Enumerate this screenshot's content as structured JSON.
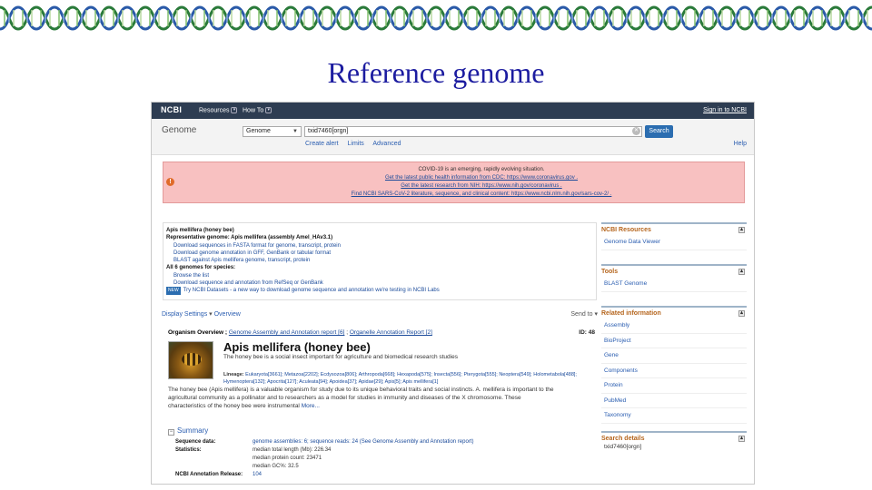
{
  "slide": {
    "title": "Reference genome"
  },
  "browser": {
    "topbar": {
      "logo": "NCBI",
      "resources": "Resources",
      "howto": "How To",
      "signin": "Sign in to NCBI"
    },
    "search": {
      "db_label": "Genome",
      "db_selected": "Genome",
      "query": "txid7460[orgn]",
      "button": "Search",
      "links": [
        "Create alert",
        "Limits",
        "Advanced"
      ],
      "help": "Help"
    },
    "alert": {
      "lines": [
        "COVID-19 is an emerging, rapidly evolving situation.",
        "Get the latest public health information from CDC: https://www.coronavirus.gov .",
        "Get the latest research from NIH: https://www.nih.gov/coronavirus .",
        "Find NCBI SARS-CoV-2 literature, sequence, and clinical content: https://www.ncbi.nlm.nih.gov/sars-cov-2/ ."
      ]
    },
    "mainbox": {
      "lines": [
        "Apis mellifera (honey bee)",
        "Representative genome: Apis mellifera (assembly Amel_HAv3.1)",
        "Download sequences in FASTA format for genome, transcript, protein",
        "Download genome annotation in GFF, GenBank or tabular format",
        "BLAST against Apis mellifera genome, transcript, protein",
        "All 6 genomes for species:",
        "Browse the list",
        "Download sequence and annotation from RefSeq or GenBank",
        "Try NCBI Datasets - a new way to download genome sequence and annotation we're testing in NCBI Labs"
      ],
      "ncbi_tag": "NEW"
    },
    "display_bar": {
      "settings": "Display Settings",
      "overview": "Overview",
      "send_to": "Send to"
    },
    "organism": {
      "header_prefix": "Organism Overview ;",
      "header_link1": "Genome Assembly and Annotation report [6]",
      "header_sep": ";",
      "header_link2": "Organelle Annotation Report [2]",
      "id": "ID: 48",
      "name": "Apis mellifera (honey bee)",
      "desc": "The honey bee is a social insect important for agriculture and biomedical research studies",
      "lineage_label": "Lineage:",
      "lineage": "Eukaryota[3661]; Metazoa[2202]; Ecdysozoa[806]; Arthropoda[668]; Hexapoda[575]; Insecta[556]; Pterygota[555]; Neoptera[549]; Holometabola[488]; Hymenoptera[132]; Apocrita[127]; Aculeata[94]; Apoidea[37]; Apidae[29]; Apis[5]; Apis mellifera[1]",
      "long_desc_1": "The honey bee (Apis mellifera) is a valuable organism for study due to its unique behavioral traits and social instincts. A. mellifera is important to the",
      "long_desc_2": "agricultural community as a pollinator and to researchers as a model for studies in immunity and diseases of the X chromosome. These",
      "long_desc_3": "characteristics of the honey bee were instrumental",
      "more": "More..."
    },
    "summary": {
      "title": "Summary",
      "rows": [
        {
          "k": "Sequence data:",
          "v": "genome assemblies: 6; sequence reads: 24 (See Genome Assembly and Annotation report)"
        },
        {
          "k": "Statistics:",
          "v": "median total length (Mb): 226.34"
        },
        {
          "k": "",
          "v": "median protein count: 23471"
        },
        {
          "k": "",
          "v": "median GC%: 32.5"
        },
        {
          "k": "NCBI Annotation Release:",
          "v": "104"
        }
      ]
    },
    "sidebar": {
      "ncbi_resources": {
        "title": "NCBI Resources",
        "items": [
          "Genome Data Viewer"
        ]
      },
      "tools": {
        "title": "Tools",
        "items": [
          "BLAST Genome"
        ]
      },
      "related": {
        "title": "Related information",
        "items": [
          "Assembly",
          "BioProject",
          "Gene",
          "Components",
          "Protein",
          "PubMed",
          "Taxonomy"
        ]
      },
      "search_details": {
        "title": "Search details",
        "query": "txid7460[orgn]"
      }
    }
  }
}
